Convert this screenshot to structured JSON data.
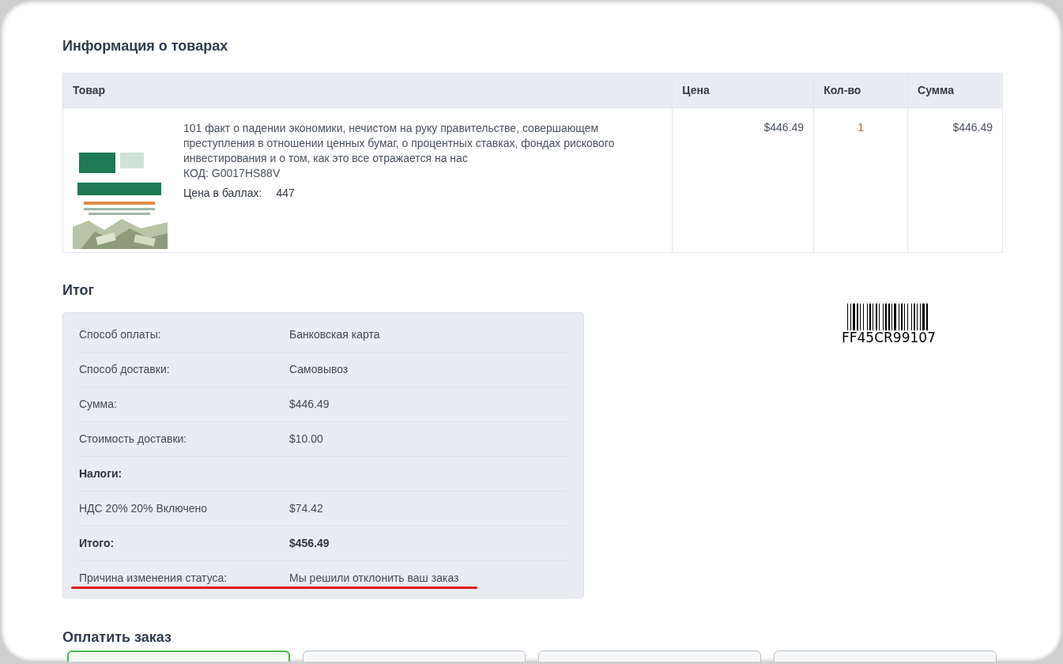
{
  "products": {
    "title": "Информация о товарах",
    "columns": [
      "Товар",
      "Цена",
      "Кол-во",
      "Сумма"
    ],
    "rows": [
      {
        "name": "101 факт о падении экономики, нечистом на руку правительстве, совершающем преступления в отношении ценных бумаг, о процентных ставках, фондах рискового инвестирования и о том, как это все отражается на нас",
        "code": "КОД: G0017HS88V",
        "points_label": "Цена в баллах:",
        "points": "447",
        "price": "$446.49",
        "quantity": "1",
        "total": "$446.49"
      }
    ]
  },
  "summary": {
    "title": "Итог",
    "rows": [
      {
        "kind": "row",
        "label": "Способ оплаты:",
        "value": "Банковская карта",
        "underlined": false
      },
      {
        "kind": "row",
        "label": "Способ доставки:",
        "value": "Самовывоз",
        "underlined": false
      },
      {
        "kind": "row",
        "label": "Сумма:",
        "value": "$446.49",
        "underlined": false
      },
      {
        "kind": "row",
        "label": "Стоимость доставки:",
        "value": "$10.00",
        "underlined": false
      },
      {
        "kind": "heading",
        "label": "Налоги:",
        "underlined": false
      },
      {
        "kind": "row",
        "label": "НДС 20% 20% Включено",
        "value": "$74.42",
        "underlined": false
      },
      {
        "kind": "total",
        "label": "Итого:",
        "value": "$456.49",
        "underlined": false
      },
      {
        "kind": "row",
        "label": "Причина изменения статуса:",
        "value": "Мы решили отклонить ваш заказ",
        "underlined": true
      }
    ]
  },
  "barcode": {
    "code": "FF45CR99107"
  },
  "payment": {
    "title": "Оплатить заказ",
    "options": [
      {
        "selected": true
      },
      {
        "selected": false
      },
      {
        "selected": false
      },
      {
        "selected": false
      }
    ]
  }
}
